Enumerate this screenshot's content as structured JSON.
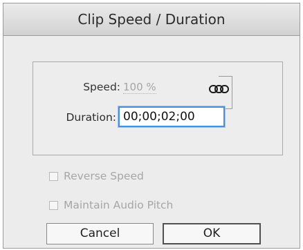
{
  "dialog": {
    "title": "Clip Speed / Duration"
  },
  "speed": {
    "label": "Speed:",
    "value": "100 %"
  },
  "duration": {
    "label": "Duration:",
    "value": "00;00;02;00"
  },
  "link_icon": "chain-link-icon",
  "options": {
    "reverse_speed": {
      "label": "Reverse Speed",
      "checked": false,
      "enabled": false
    },
    "maintain_pitch": {
      "label": "Maintain Audio Pitch",
      "checked": false,
      "enabled": false
    }
  },
  "buttons": {
    "cancel_label": "Cancel",
    "ok_label": "OK"
  }
}
